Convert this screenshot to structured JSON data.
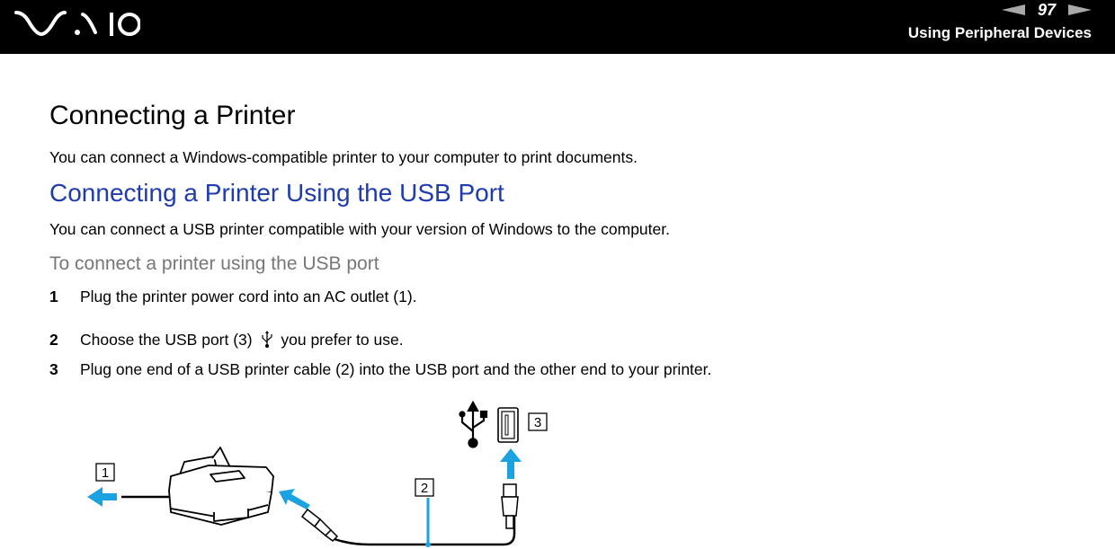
{
  "header": {
    "brand": "VAIO",
    "page_number": "97",
    "section_title": "Using Peripheral Devices",
    "prev_icon": "arrow-left-icon",
    "next_icon": "arrow-right-icon"
  },
  "main": {
    "title": "Connecting a Printer",
    "intro": "You can connect a Windows-compatible printer to your computer to print documents.",
    "subtitle": "Connecting a Printer Using the USB Port",
    "sub_intro": "You can connect a USB printer compatible with your version of Windows to the computer.",
    "procedure_title": "To connect a printer using the USB port",
    "steps": [
      {
        "num": "1",
        "text": "Plug the printer power cord into an AC outlet (1)."
      },
      {
        "num": "2",
        "text_before": "Choose the USB port (3)",
        "icon": "usb-icon",
        "text_after": "you prefer to use."
      },
      {
        "num": "3",
        "text": "Plug one end of a USB printer cable (2) into the USB port and the other end to your printer."
      }
    ]
  },
  "figure": {
    "callouts": [
      "1",
      "2",
      "3"
    ],
    "accent_color": "#1aa3e0"
  }
}
